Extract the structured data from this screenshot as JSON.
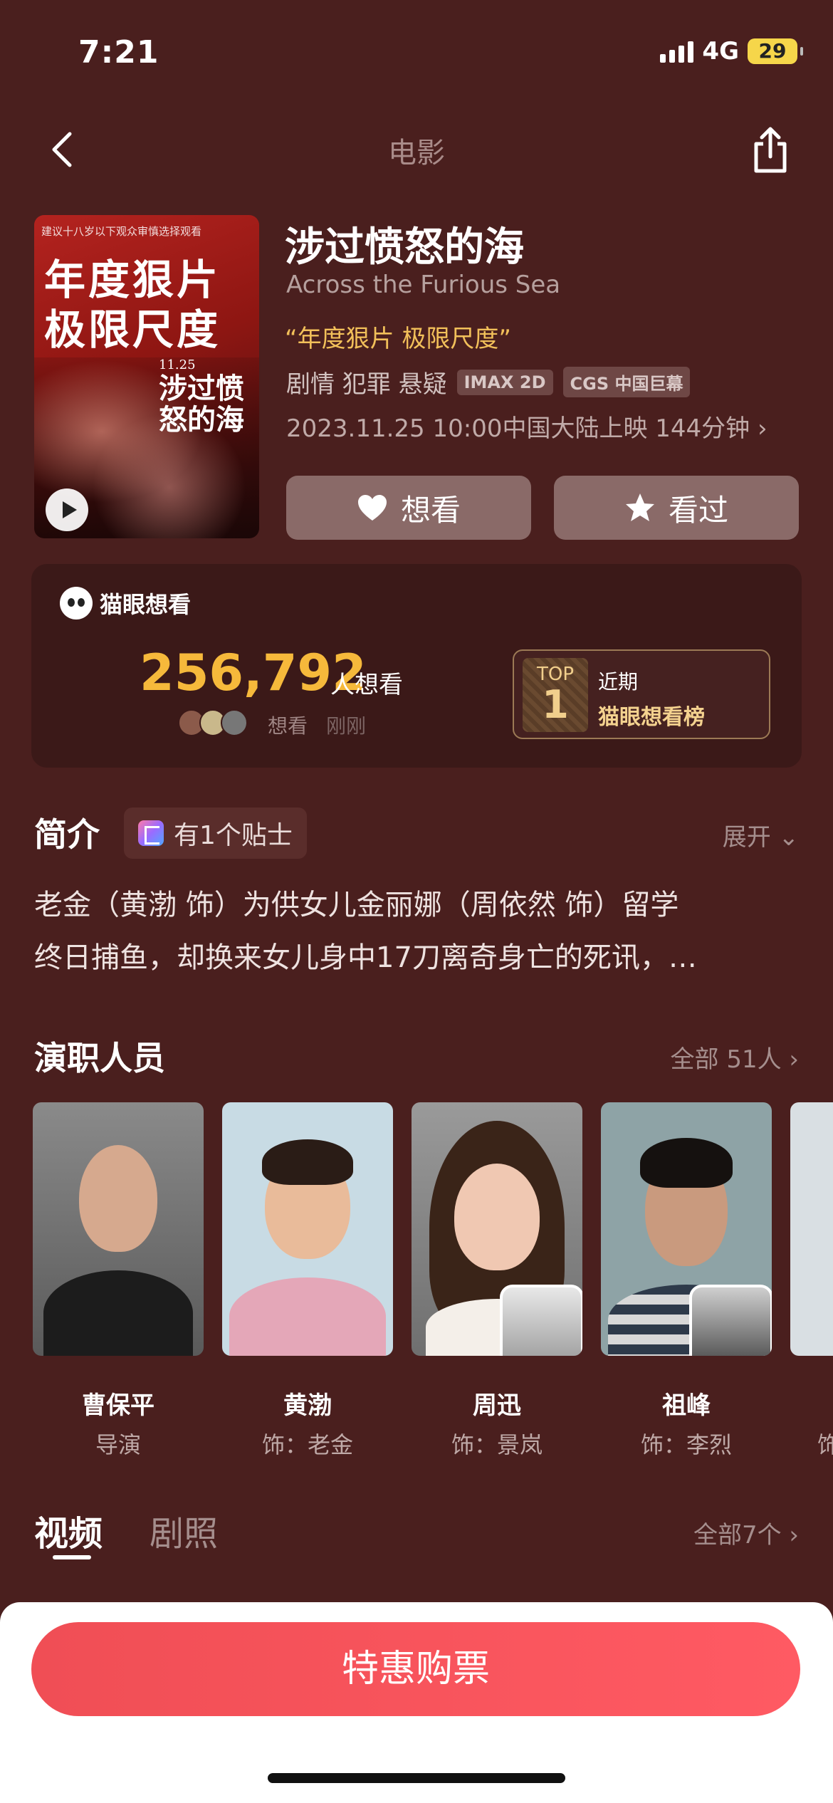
{
  "status": {
    "time": "7:21",
    "network": "4G",
    "battery": "29"
  },
  "nav": {
    "title": "电影"
  },
  "poster": {
    "top_text": "建议十八岁以下观众审慎选择观看",
    "big_text_1": "年度狠片",
    "big_text_2": "极限尺度",
    "date_text": "11.25",
    "title_text": "涉过愤怒的海"
  },
  "movie": {
    "title": "涉过愤怒的海",
    "en_title": "Across the Furious Sea",
    "tagline": "“年度狠片 极限尺度”",
    "genres": "剧情 犯罪 悬疑",
    "badges": [
      "IMAX 2D",
      "CGS 中国巨幕"
    ],
    "release": "2023.11.25 10:00中国大陆上映 144分钟 ›"
  },
  "actions": {
    "want": "想看",
    "seen": "看过"
  },
  "want_card": {
    "brand": "猫眼想看",
    "count": "256,792",
    "unit": "人想看",
    "recent_label": "想看",
    "recent_time": "刚刚",
    "rank_top": "TOP",
    "rank_num": "1",
    "rank_recent": "近期",
    "rank_name": "猫眼想看榜"
  },
  "intro": {
    "title": "简介",
    "tips": "有1个贴士",
    "expand": "展开 ⌄",
    "line1": "老金（黄渤 饰）为供女儿金丽娜（周依然 饰）留学",
    "line2": "终日捕鱼，却换来女儿身中17刀离奇身亡的死讯，…"
  },
  "cast": {
    "title": "演职人员",
    "all": "全部 51人 ›",
    "members": [
      {
        "name": "曹保平",
        "role": "导演"
      },
      {
        "name": "黄渤",
        "role": "饰：老金"
      },
      {
        "name": "周迅",
        "role": "饰：景岚"
      },
      {
        "name": "祖峰",
        "role": "饰：李烈"
      },
      {
        "name": "",
        "role": "饰"
      }
    ]
  },
  "media": {
    "tab_video": "视频",
    "tab_photo": "剧照",
    "all": "全部7个 ›"
  },
  "buy": {
    "label": "特惠购票"
  },
  "colors": {
    "background": "#4a1f1e",
    "accent": "#f6b93b",
    "buy": "#f04e55"
  }
}
